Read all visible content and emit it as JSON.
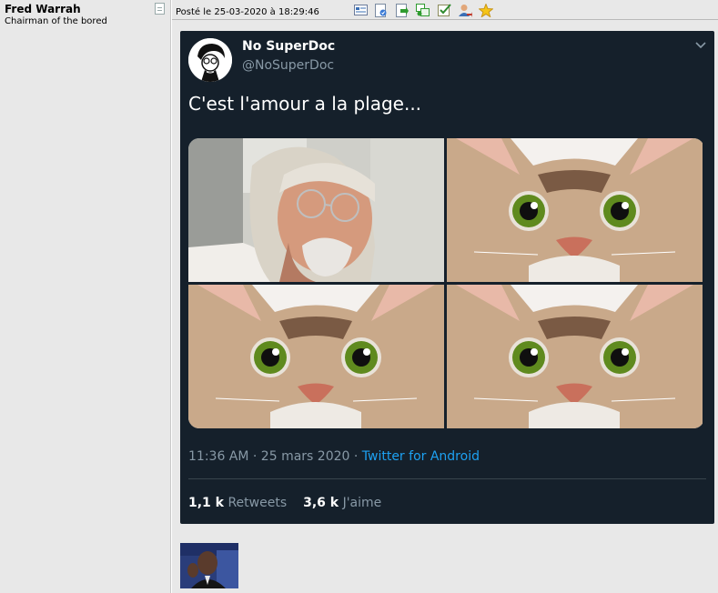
{
  "user": {
    "name": "Fred Warrah",
    "title": "Chairman of the bored"
  },
  "post": {
    "date_text": "Posté le 25-03-2020 à 18:29:46",
    "tools": [
      "message-icon",
      "edit-icon",
      "reply-icon",
      "quote-icon",
      "check-icon",
      "user-icon",
      "star-icon"
    ]
  },
  "tweet": {
    "author_name": "No SuperDoc",
    "author_handle": "@NoSuperDoc",
    "text": "C'est l'amour a la plage...",
    "time": "11:36 AM · 25 mars 2020 · ",
    "source": "Twitter for Android",
    "retweets_count": "1,1 k",
    "retweets_label": " Retweets",
    "likes_count": "3,6 k",
    "likes_label": " J'aime",
    "background": "#15202b",
    "link_color": "#1da1f2"
  },
  "colors": {
    "panel": "#e8e8e8",
    "muted": "#8899a6"
  }
}
